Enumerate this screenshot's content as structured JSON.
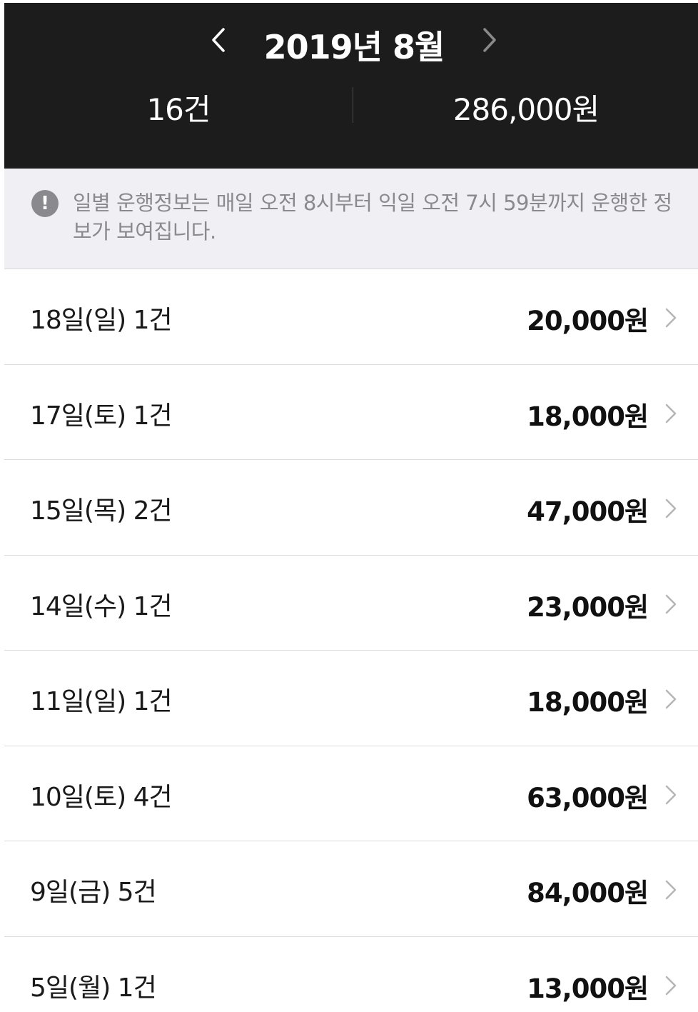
{
  "header": {
    "month_title": "2019년 8월",
    "prev_icon": "chevron-left-icon",
    "next_icon": "chevron-right-icon",
    "count": "16건",
    "total": "286,000원",
    "colors": {
      "background": "#1c1c1c",
      "text": "#ffffff",
      "next_arrow": "#8a8a8a"
    }
  },
  "notice": {
    "icon": "exclamation-icon",
    "text": "일별 운행정보는 매일 오전 8시부터 익일 오전 7시 59분까지 운행한 정보가 보여집니다.",
    "colors": {
      "background": "#f0f0f4",
      "text": "#8a8a8e"
    }
  },
  "days": [
    {
      "label": "18일(일) 1건",
      "amount": "20,000원"
    },
    {
      "label": "17일(토) 1건",
      "amount": "18,000원"
    },
    {
      "label": "15일(목) 2건",
      "amount": "47,000원"
    },
    {
      "label": "14일(수) 1건",
      "amount": "23,000원"
    },
    {
      "label": "11일(일) 1건",
      "amount": "18,000원"
    },
    {
      "label": "10일(토) 4건",
      "amount": "63,000원"
    },
    {
      "label": "9일(금) 5건",
      "amount": "84,000원"
    },
    {
      "label": "5일(월) 1건",
      "amount": "13,000원"
    }
  ]
}
